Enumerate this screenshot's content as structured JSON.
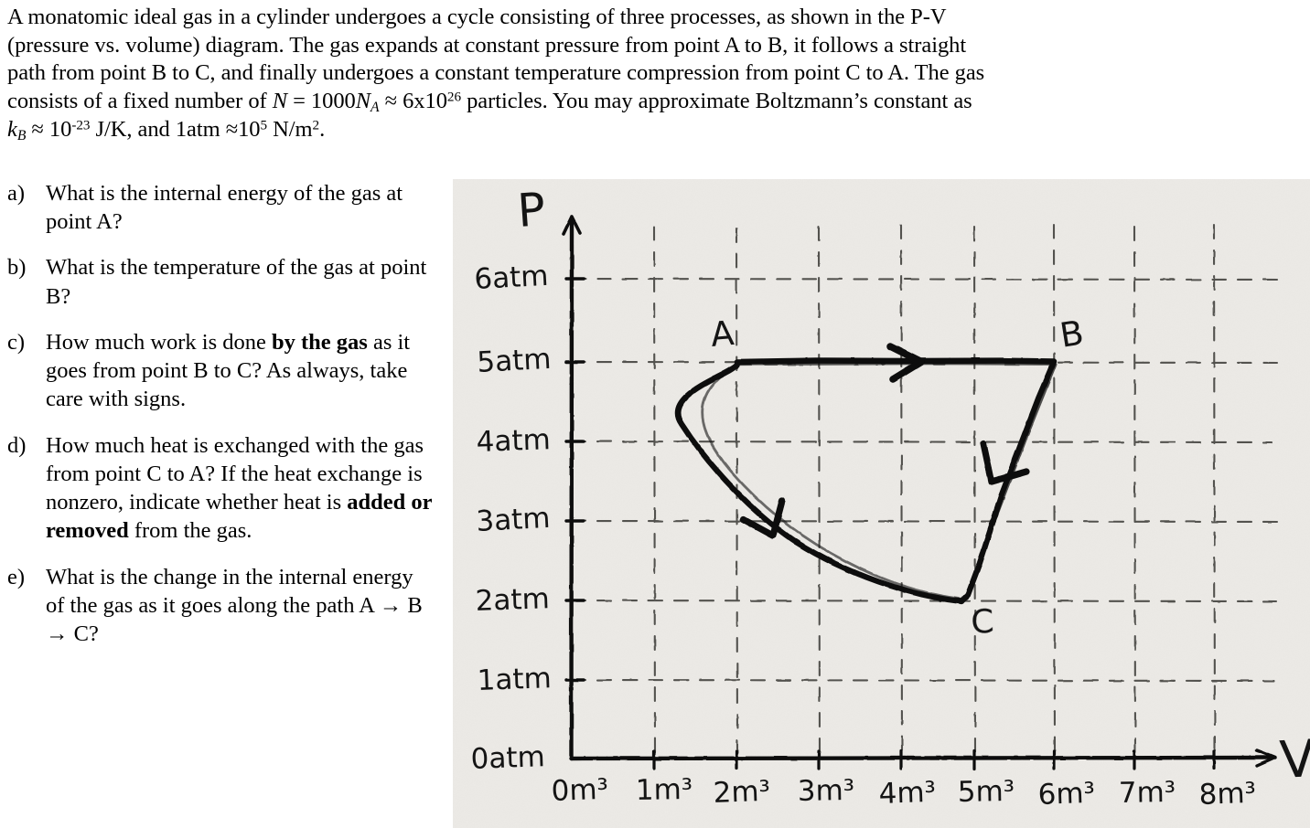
{
  "problem": {
    "lines": [
      "A monatomic ideal gas in a cylinder undergoes a cycle consisting of three processes, as shown in the P-V",
      "(pressure vs. volume) diagram.  The gas expands at constant pressure from point A to B, it follows a straight",
      "path from point B to C, and finally undergoes a constant temperature compression from point C to A. The gas"
    ],
    "line4_pre": "consists of a fixed number of ",
    "line4_N": "N",
    "line4_eq": " = 1000",
    "line4_NA": "N",
    "line4_NA_sub": "A",
    "line4_approx": " ≈ 6x10",
    "line4_exp": "26",
    "line4_post": " particles. You may approximate Boltzmann’s constant as",
    "line5_k": "k",
    "line5_k_sub": "B",
    "line5_approx": " ≈ 10",
    "line5_exp": "-23",
    "line5_mid": " J/K, and 1atm ≈10",
    "line5_exp2": "5",
    "line5_end": " N/m",
    "line5_exp3": "2",
    "line5_period": "."
  },
  "questions": [
    {
      "marker": "a)",
      "segments": [
        {
          "text": "What is the internal energy of the gas at point A?",
          "bold": false
        }
      ]
    },
    {
      "marker": "b)",
      "segments": [
        {
          "text": "What is the temperature of the gas at point B?",
          "bold": false
        }
      ]
    },
    {
      "marker": "c)",
      "segments": [
        {
          "text": "How much work is done ",
          "bold": false
        },
        {
          "text": "by the gas",
          "bold": true
        },
        {
          "text": " as it goes from point B to C? As always, take care with signs.",
          "bold": false
        }
      ]
    },
    {
      "marker": "d)",
      "segments": [
        {
          "text": "How much heat is exchanged with the gas from point C to A? If the heat exchange is nonzero, indicate whether heat is ",
          "bold": false
        },
        {
          "text": "added or removed",
          "bold": true
        },
        {
          "text": " from the gas.",
          "bold": false
        }
      ]
    },
    {
      "marker": "e)",
      "segments": [
        {
          "text": "What is the change in the internal energy of the gas as it goes along the path A → B → C?",
          "bold": false
        }
      ]
    }
  ],
  "chart_data": {
    "type": "line",
    "title": "",
    "style": "hand-drawn P-V diagram on paper",
    "xlabel": "V",
    "ylabel": "P",
    "x_tick_labels": [
      "0m³",
      "1m³",
      "2m³",
      "3m³",
      "4m³",
      "5m³",
      "6m³",
      "7m³",
      "8m³"
    ],
    "x_tick_values": [
      0,
      1,
      2,
      3,
      4,
      5,
      6,
      7,
      8
    ],
    "y_tick_labels": [
      "0atm",
      "1atm",
      "2atm",
      "3atm",
      "4atm",
      "5atm",
      "6atm"
    ],
    "y_tick_values": [
      0,
      1,
      2,
      3,
      4,
      5,
      6
    ],
    "xlim": [
      0,
      8
    ],
    "ylim": [
      0,
      6.4
    ],
    "grid": true,
    "grid_style": "dashed",
    "points": [
      {
        "label": "A",
        "v": 2,
        "p": 5
      },
      {
        "label": "B",
        "v": 6,
        "p": 5
      },
      {
        "label": "C",
        "v": 5,
        "p": 2
      }
    ],
    "processes": [
      {
        "from": "A",
        "to": "B",
        "kind": "isobaric",
        "shape": "straight horizontal",
        "arrow": true
      },
      {
        "from": "B",
        "to": "C",
        "kind": "straight line",
        "shape": "straight",
        "arrow": true
      },
      {
        "from": "C",
        "to": "A",
        "kind": "isothermal compression",
        "shape": "curved hyperbola",
        "arrow": true
      }
    ],
    "paper_color": "#eceae6",
    "ink_color": "#141414"
  }
}
